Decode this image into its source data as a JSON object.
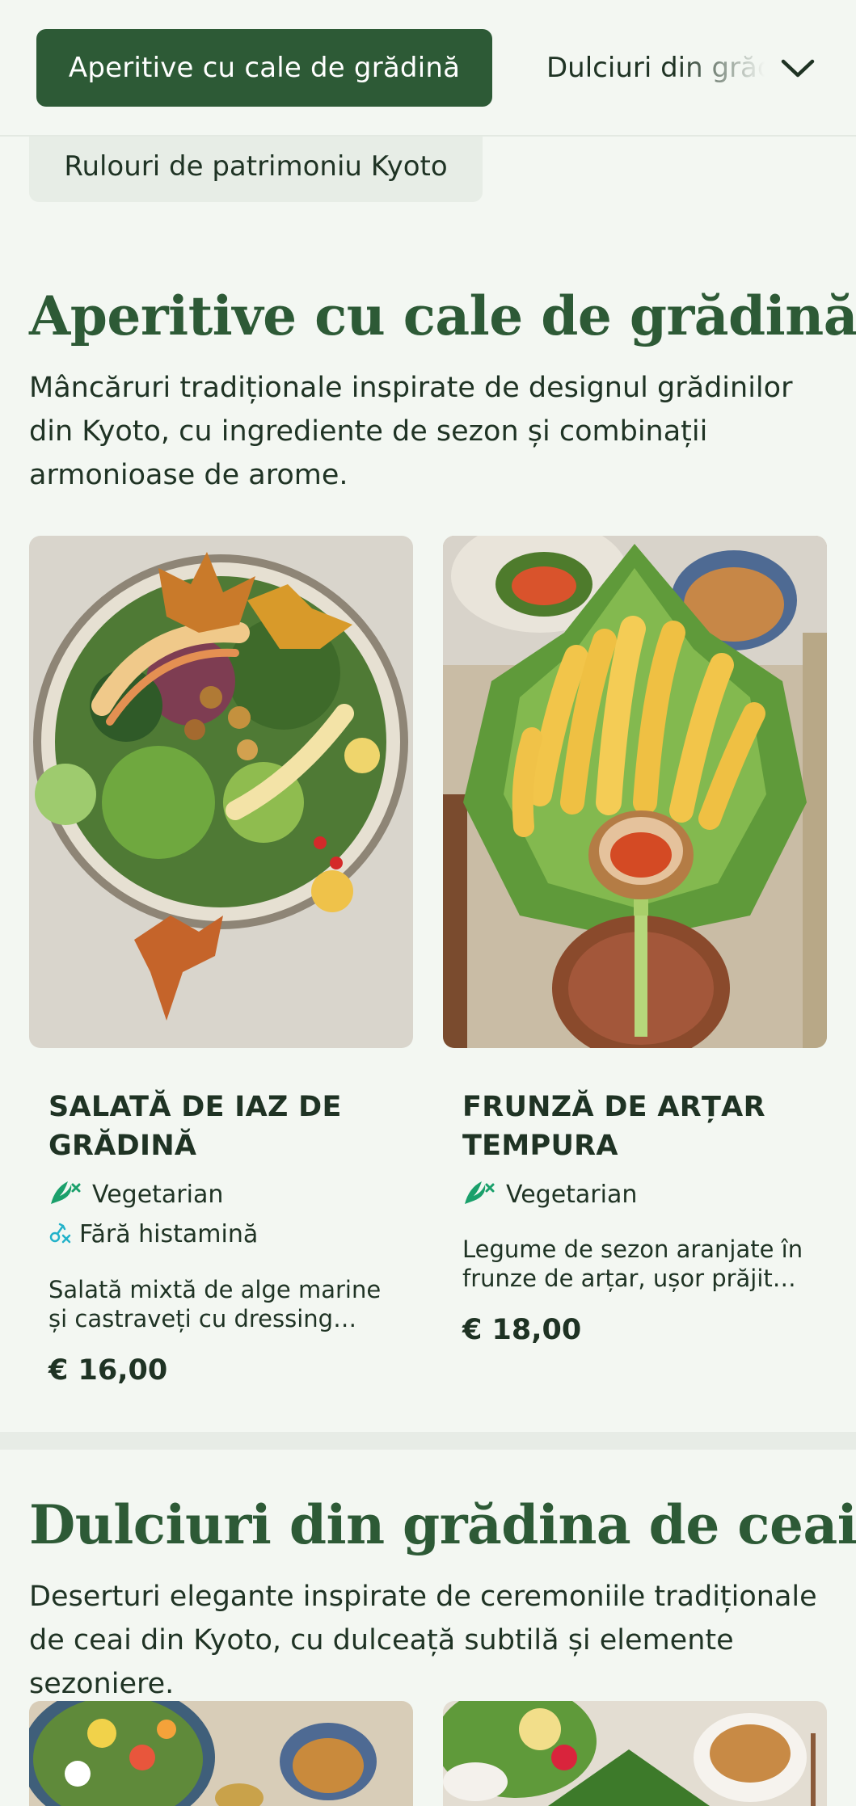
{
  "nav": {
    "active_label": "Aperitive cu cale de grădină",
    "next_label": "Dulciuri din grădina de ceai",
    "chip_label": "Rulouri de patrimoniu Kyoto"
  },
  "colors": {
    "accent": "#2d5a36",
    "background": "#f3f7f2",
    "veg_icon": "#1aa06b",
    "histamine_icon": "#22b2c9"
  },
  "sections": [
    {
      "title": "Aperitive cu cale de grădină",
      "description": "Mâncăruri tradiționale inspirate de designul grădinilor din Kyoto, cu ingrediente de sezon și combinații armonioase de arome.",
      "items": [
        {
          "name": "Salată de iaz de grădină",
          "tags": [
            "Vegetarian",
            "Fără histamină"
          ],
          "description": "Salată mixtă de alge marine și castraveți cu dressing infuzat cu yuzu",
          "price": "€ 16,00"
        },
        {
          "name": "Frunză de arțar tempura",
          "tags": [
            "Vegetarian"
          ],
          "description": "Legume de sezon aranjate în frunze de arțar, ușor prăjite în aluat tempura",
          "price": "€ 18,00"
        }
      ]
    },
    {
      "title": "Dulciuri din grădina de ceai",
      "description": "Deserturi elegante inspirate de ceremoniile tradiționale de ceai din Kyoto, cu dulceață subtilă și elemente sezoniere."
    }
  ]
}
